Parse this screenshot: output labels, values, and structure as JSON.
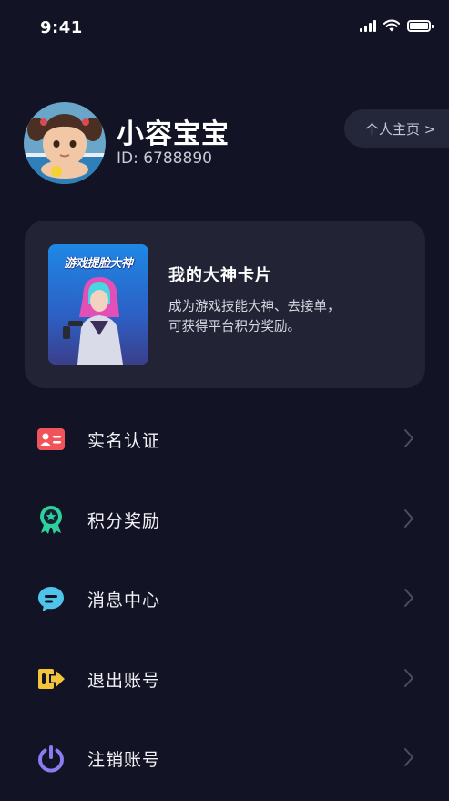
{
  "status_bar": {
    "time": "9:41"
  },
  "profile": {
    "username": "小容宝宝",
    "id_text": "ID: 6788890",
    "homepage_button": "个人主页 >"
  },
  "god_card": {
    "image_title": "游戏提脸大神",
    "title": "我的大神卡片",
    "desc_line1": "成为游戏技能大神、去接单，",
    "desc_line2": "可获得平台积分奖励。"
  },
  "menu": {
    "items": [
      {
        "label": "实名认证",
        "icon": "id-card-icon",
        "color": "#f0545a"
      },
      {
        "label": "积分奖励",
        "icon": "award-ribbon-icon",
        "color": "#2fcf9c"
      },
      {
        "label": "消息中心",
        "icon": "chat-bubble-icon",
        "color": "#4fc3e8"
      },
      {
        "label": "退出账号",
        "icon": "logout-arrow-icon",
        "color": "#f4c43a"
      },
      {
        "label": "注销账号",
        "icon": "power-icon",
        "color": "#8a7bf0"
      }
    ]
  },
  "colors": {
    "background": "#121324",
    "card": "#222436"
  }
}
